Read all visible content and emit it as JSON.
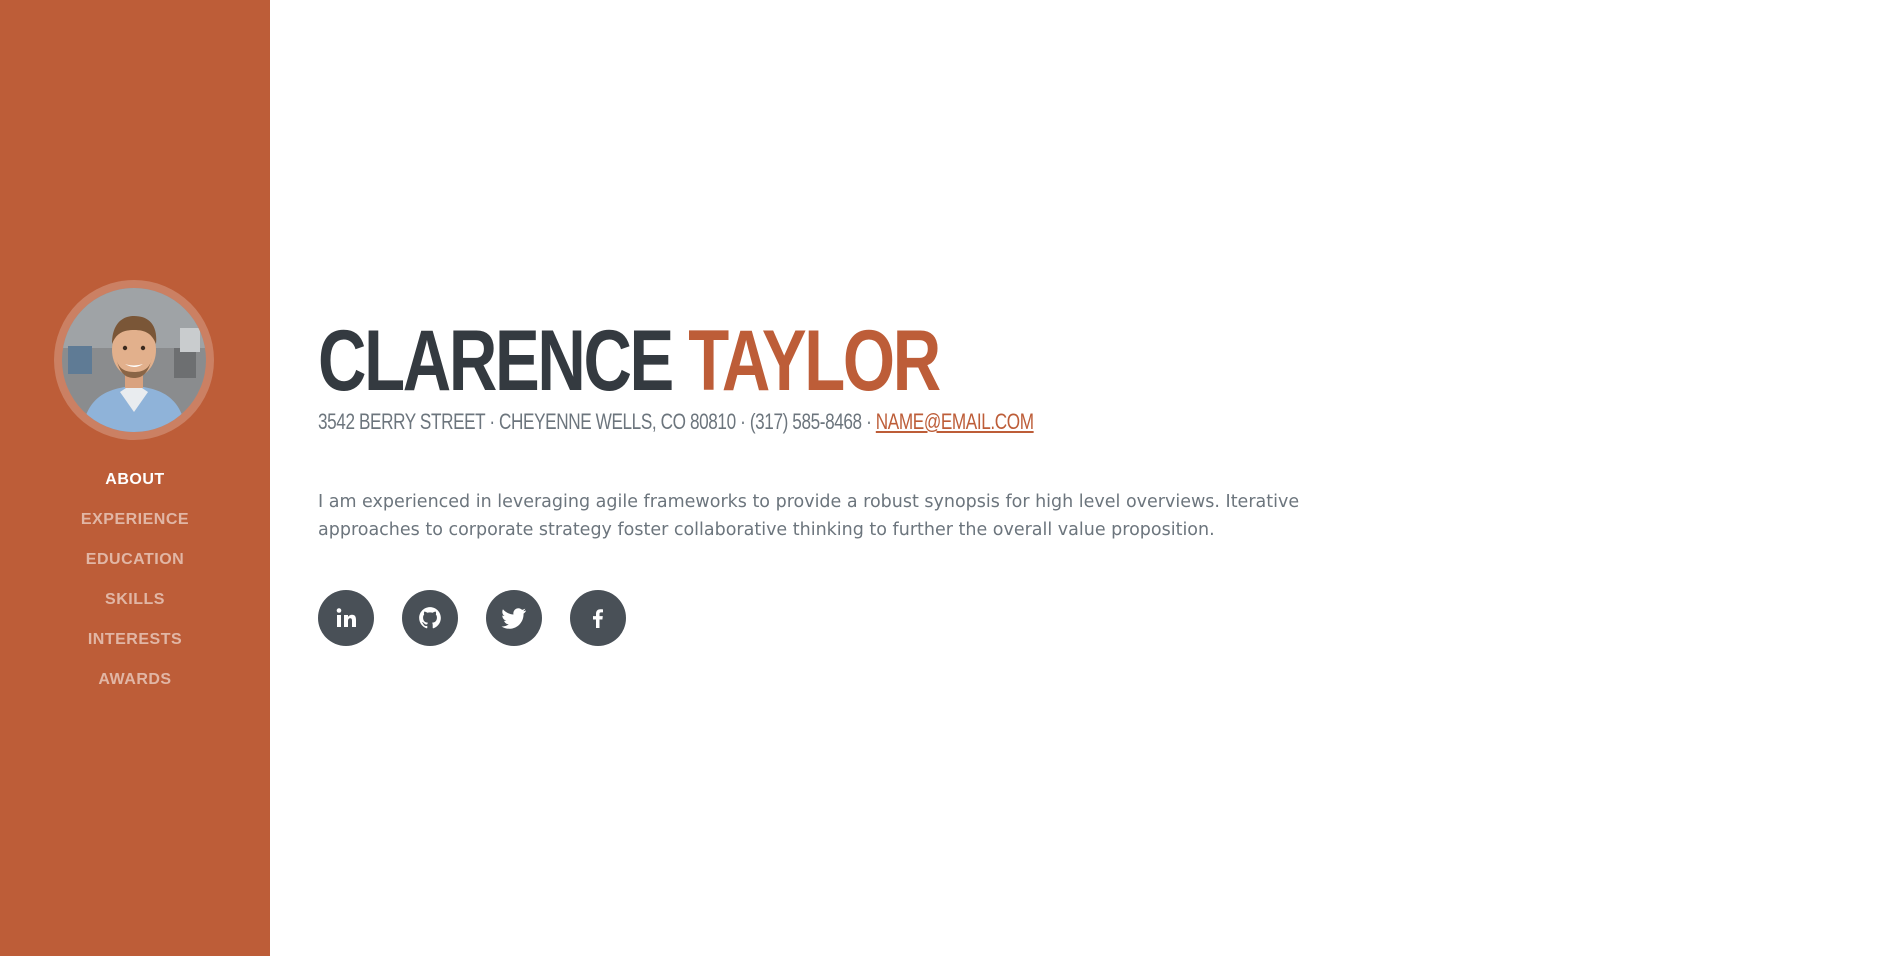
{
  "profile": {
    "avatar_alt": "Profile photo"
  },
  "nav": {
    "items": [
      {
        "label": "About"
      },
      {
        "label": "Experience"
      },
      {
        "label": "Education"
      },
      {
        "label": "Skills"
      },
      {
        "label": "Interests"
      },
      {
        "label": "Awards"
      }
    ],
    "active_index": 0
  },
  "about": {
    "first_name": "Clarence",
    "last_name": "Taylor",
    "address": "3542 Berry Street · Cheyenne Wells, CO 80810 · (317) 585-8468 ·",
    "email": "name@email.com",
    "bio": "I am experienced in leveraging agile frameworks to provide a robust synopsis for high level overviews. Iterative approaches to corporate strategy foster collaborative thinking to further the overall value proposition."
  },
  "socials": [
    {
      "icon": "linkedin-icon"
    },
    {
      "icon": "github-icon"
    },
    {
      "icon": "twitter-icon"
    },
    {
      "icon": "facebook-icon"
    }
  ],
  "colors": {
    "primary": "#bd5d38",
    "dark": "#343a40",
    "muted": "#6c757d",
    "social_bg": "#495057"
  }
}
